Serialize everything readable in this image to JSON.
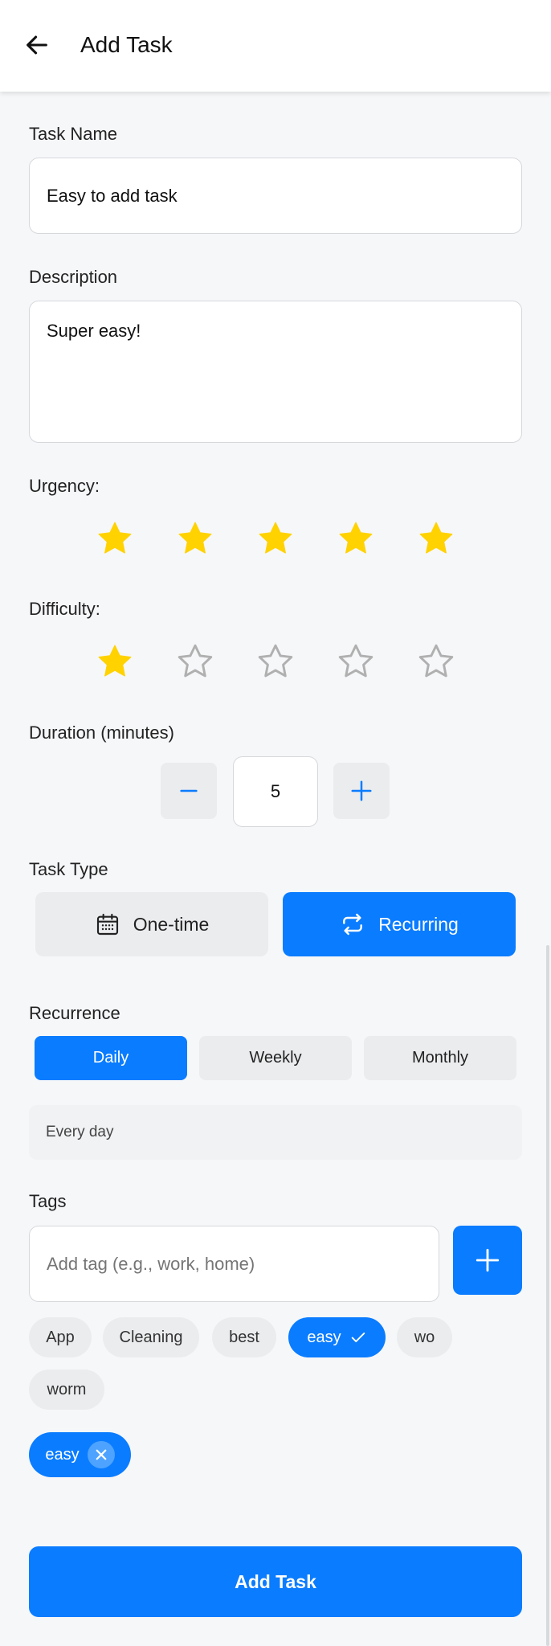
{
  "header": {
    "title": "Add Task",
    "back_icon": "arrow-left-icon"
  },
  "form": {
    "task_name_label": "Task Name",
    "task_name_value": "Easy to add task",
    "description_label": "Description",
    "description_value": "Super easy!",
    "urgency_label": "Urgency:",
    "urgency_rating": 5,
    "difficulty_label": "Difficulty:",
    "difficulty_rating": 1,
    "max_rating": 5,
    "duration_label": "Duration (minutes)",
    "duration_value": "5",
    "task_type_label": "Task Type",
    "task_type_options": [
      {
        "label": "One-time",
        "icon": "calendar-icon",
        "selected": false
      },
      {
        "label": "Recurring",
        "icon": "repeat-icon",
        "selected": true
      }
    ],
    "recurrence_label": "Recurrence",
    "recurrence_options": [
      {
        "label": "Daily",
        "selected": true
      },
      {
        "label": "Weekly",
        "selected": false
      },
      {
        "label": "Monthly",
        "selected": false
      }
    ],
    "recurrence_summary": "Every day",
    "tags_label": "Tags",
    "tag_input_placeholder": "Add tag (e.g., work, home)",
    "tag_suggestions": [
      {
        "label": "App",
        "selected": false
      },
      {
        "label": "Cleaning",
        "selected": false
      },
      {
        "label": "best",
        "selected": false
      },
      {
        "label": "easy",
        "selected": true
      },
      {
        "label": "wo",
        "selected": false
      },
      {
        "label": "worm",
        "selected": false
      }
    ],
    "selected_tags": [
      "easy"
    ],
    "submit_label": "Add Task"
  },
  "colors": {
    "accent": "#0a7cff",
    "star_filled": "#ffd200",
    "star_empty": "#b0b0b0",
    "chip_bg": "#ebecee",
    "background": "#f6f7f9"
  }
}
